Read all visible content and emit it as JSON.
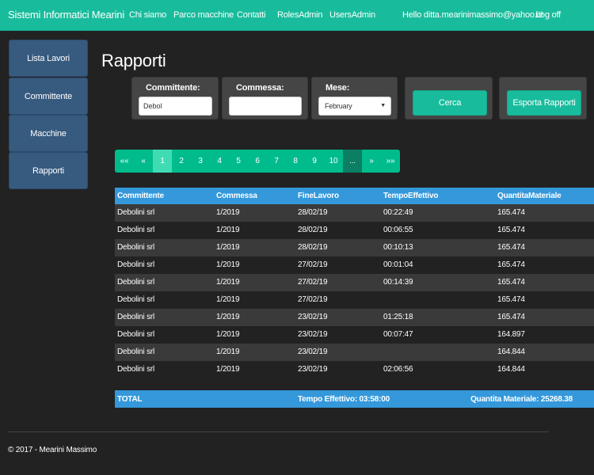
{
  "navbar": {
    "brand": "Sistemi Informatici Mearini",
    "links": [
      "Chi siamo",
      "Parco macchine",
      "Contatti",
      "RolesAdmin",
      "UsersAdmin"
    ],
    "greeting": "Hello ditta.mearinimassimo@yahoo.it!",
    "logoff": "Log off",
    "color": "#18bc9c"
  },
  "sidebar": {
    "items": [
      {
        "label": "Lista Lavori"
      },
      {
        "label": "Committente"
      },
      {
        "label": "Macchine"
      },
      {
        "label": "Rapporti"
      }
    ]
  },
  "page": {
    "title": "Rapporti"
  },
  "filters": {
    "committente": {
      "label": "Committente:",
      "value": "Debol"
    },
    "commessa": {
      "label": "Commessa:",
      "value": ""
    },
    "mese": {
      "label": "Mese:",
      "value": "February"
    },
    "cerca_label": "Cerca",
    "esporta_label": "Esporta Rapporti"
  },
  "pagination": {
    "first": "««",
    "prev": "«",
    "pages": [
      "1",
      "2",
      "3",
      "4",
      "5",
      "6",
      "7",
      "8",
      "9",
      "10"
    ],
    "ellipsis": "...",
    "next": "»",
    "last": "»»",
    "active_page": "1"
  },
  "table": {
    "headers": [
      "Committente",
      "Commessa",
      "FineLavoro",
      "TempoEffettivo",
      "QuantitaMateriale"
    ],
    "rows": [
      [
        "Debolini srl",
        "1/2019",
        "28/02/19",
        "00:22:49",
        "165.474"
      ],
      [
        "Debolini srl",
        "1/2019",
        "28/02/19",
        "00:06:55",
        "165.474"
      ],
      [
        "Debolini srl",
        "1/2019",
        "28/02/19",
        "00:10:13",
        "165.474"
      ],
      [
        "Debolini srl",
        "1/2019",
        "27/02/19",
        "00:01:04",
        "165.474"
      ],
      [
        "Debolini srl",
        "1/2019",
        "27/02/19",
        "00:14:39",
        "165.474"
      ],
      [
        "Debolini srl",
        "1/2019",
        "27/02/19",
        "",
        "165.474"
      ],
      [
        "Debolini srl",
        "1/2019",
        "23/02/19",
        "01:25:18",
        "165.474"
      ],
      [
        "Debolini srl",
        "1/2019",
        "23/02/19",
        "00:07:47",
        "164.897"
      ],
      [
        "Debolini srl",
        "1/2019",
        "23/02/19",
        "",
        "164.844"
      ],
      [
        "Debolini srl",
        "1/2019",
        "23/02/19",
        "02:06:56",
        "164.844"
      ]
    ]
  },
  "totals": {
    "label": "TOTAL",
    "tempo": "Tempo Effettivo: 03:58:00",
    "quantita": "Quantita Materiale: 25268.38",
    "color": "#3498db"
  },
  "footer": {
    "text": "© 2017 - Mearini Massimo"
  }
}
